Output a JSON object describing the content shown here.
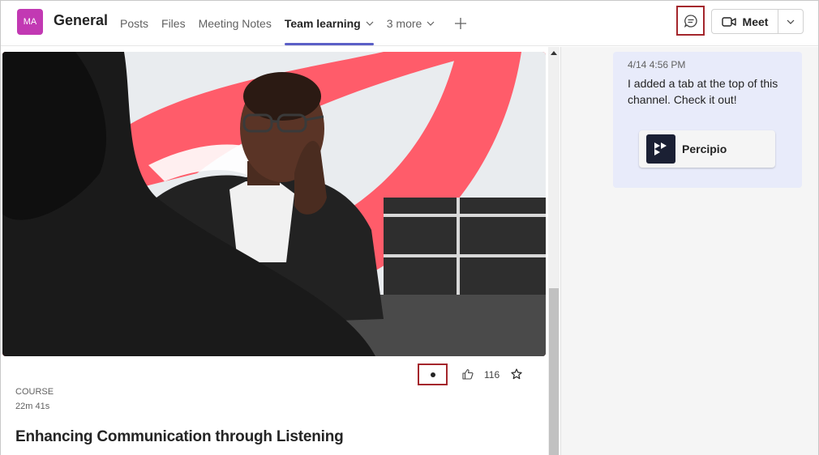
{
  "header": {
    "avatar_initials": "MA",
    "channel_name": "General",
    "tabs": [
      {
        "label": "Posts"
      },
      {
        "label": "Files"
      },
      {
        "label": "Meeting Notes"
      },
      {
        "label": "Team learning",
        "active": true
      },
      {
        "label": "3 more"
      }
    ],
    "meet_label": "Meet"
  },
  "card": {
    "type_label": "COURSE",
    "duration": "22m 41s",
    "title": "Enhancing Communication through Listening",
    "like_count": "116"
  },
  "side": {
    "timestamp": "4/14 4:56 PM",
    "message": "I added a tab at the top of this channel. Check it out!",
    "app_name": "Percipio"
  },
  "colors": {
    "accent": "#5b5fc7",
    "avatar": "#c239b3",
    "highlight_border": "#a4262c",
    "image_bg": "#ff5c6a"
  }
}
